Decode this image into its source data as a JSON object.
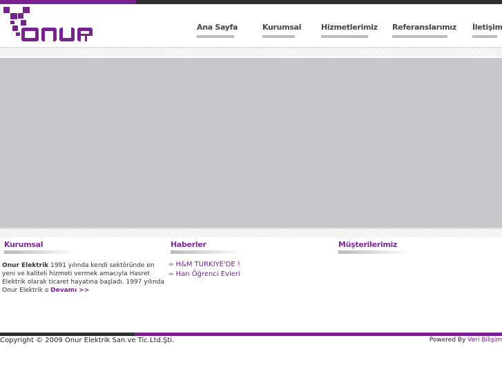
{
  "logo": {
    "text": "ONUR"
  },
  "nav": [
    "Ana Sayfa",
    "Kurumsal",
    "Hizmetlerimiz",
    "Referanslarımız",
    "İletişim"
  ],
  "sections": {
    "kurumsal": "Kurumsal",
    "haberler": "Haberler",
    "musteriler": "Müşterilerimiz"
  },
  "about": {
    "bold": "Onur Elektrik",
    "text": " 1991 yılında kendi sektöründe en yeni ve kaliteli hizmeti vermek amacıyla Hasret Elektrik olarak ticaret hayatına başladı. 1997 yılında Onur Elektrik o ",
    "more": "Devamı >>"
  },
  "news": [
    "H&M TURKIYE'DE !",
    "Han Öğrenci Evleri"
  ],
  "news_icon": "⇼",
  "footer": {
    "copyright": "Copyright © 2009 Onur Elektrik San.ve Tic.Ltd.Şti.",
    "powered": "Powered By ",
    "powered_link": "Veri Bilişim"
  },
  "colors": {
    "brand": "#74248c",
    "dark": "#303030"
  }
}
